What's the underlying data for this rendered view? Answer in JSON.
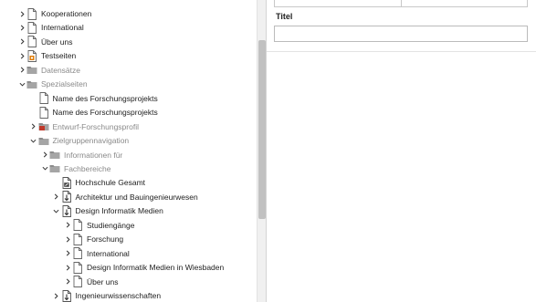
{
  "tree": {
    "items": [
      {
        "label": "Kooperationen",
        "icon": "page-icon",
        "expand": "chevron-right",
        "level": 0,
        "muted": false
      },
      {
        "label": "International",
        "icon": "page-icon",
        "expand": "chevron-right",
        "level": 0,
        "muted": false
      },
      {
        "label": "Über uns",
        "icon": "page-icon",
        "expand": "chevron-right",
        "level": 0,
        "muted": false
      },
      {
        "label": "Testseiten",
        "icon": "page-special-icon",
        "expand": "chevron-right",
        "level": 0,
        "muted": false
      },
      {
        "label": "Datensätze",
        "icon": "folder-icon",
        "expand": "chevron-right",
        "level": 0,
        "muted": true
      },
      {
        "label": "Spezialseiten",
        "icon": "folder-icon",
        "expand": "chevron-down",
        "level": 0,
        "muted": true
      },
      {
        "label": "Name des Forschungsprojekts",
        "icon": "page-icon",
        "expand": "none",
        "level": 1,
        "muted": false
      },
      {
        "label": "Name des Forschungsprojekts",
        "icon": "page-icon",
        "expand": "none",
        "level": 1,
        "muted": false
      },
      {
        "label": "Entwurf-Forschungsprofil",
        "icon": "folder-red-icon",
        "expand": "chevron-right",
        "level": 1,
        "muted": true
      },
      {
        "label": "Zielgruppennavigation",
        "icon": "folder-icon",
        "expand": "chevron-down",
        "level": 1,
        "muted": true
      },
      {
        "label": "Informationen für",
        "icon": "folder-icon",
        "expand": "chevron-right",
        "level": 2,
        "muted": true
      },
      {
        "label": "Fachbereiche",
        "icon": "folder-icon",
        "expand": "chevron-down",
        "level": 2,
        "muted": true
      },
      {
        "label": "Hochschule Gesamt",
        "icon": "shortcut-icon",
        "expand": "none",
        "level": 3,
        "muted": false
      },
      {
        "label": "Architektur und Bauingenieurwesen",
        "icon": "link-page-icon",
        "expand": "chevron-right",
        "level": 3,
        "muted": false
      },
      {
        "label": "Design Informatik Medien",
        "icon": "link-page-icon",
        "expand": "chevron-down",
        "level": 3,
        "muted": false
      },
      {
        "label": "Studiengänge",
        "icon": "page-icon",
        "expand": "chevron-right",
        "level": 4,
        "muted": false
      },
      {
        "label": "Forschung",
        "icon": "page-icon",
        "expand": "chevron-right",
        "level": 4,
        "muted": false
      },
      {
        "label": "International",
        "icon": "page-icon",
        "expand": "chevron-right",
        "level": 4,
        "muted": false
      },
      {
        "label": "Design Informatik Medien in Wiesbaden",
        "icon": "page-icon",
        "expand": "chevron-right",
        "level": 4,
        "muted": false
      },
      {
        "label": "Über uns",
        "icon": "page-icon",
        "expand": "chevron-right",
        "level": 4,
        "muted": false
      },
      {
        "label": "Ingenieurwissenschaften",
        "icon": "link-page-icon",
        "expand": "chevron-right",
        "level": 3,
        "muted": false
      }
    ]
  },
  "form": {
    "title_label": "Titel",
    "title_value": ""
  },
  "colors": {
    "muted_text": "#8a8a8a",
    "folder": "#8c8c8c",
    "red_accent": "#c0392b",
    "special_orange": "#e07b00"
  }
}
